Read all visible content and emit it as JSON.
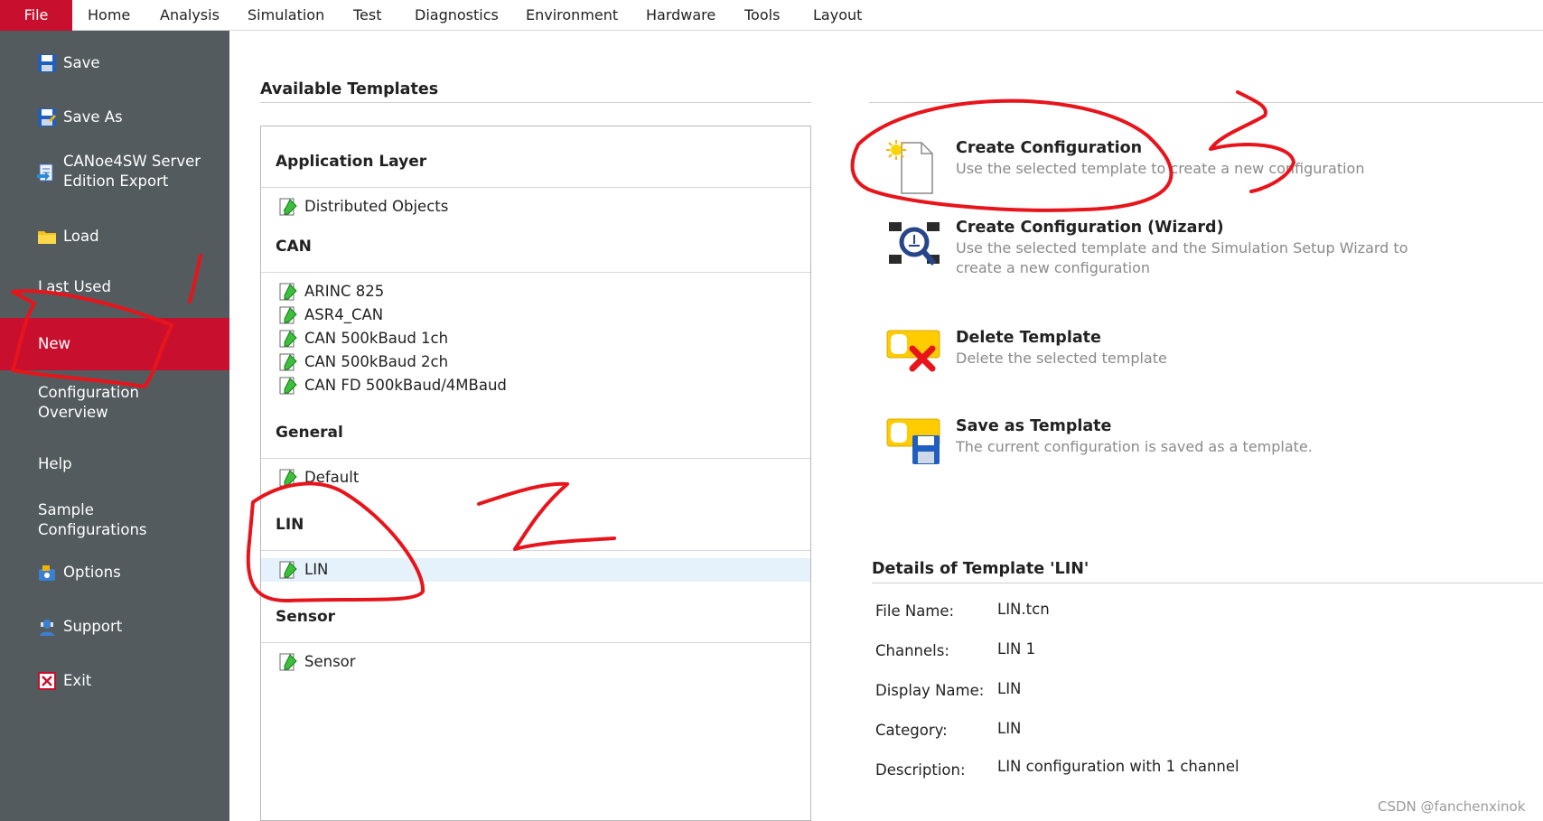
{
  "menubar": {
    "file": "File",
    "tabs": [
      "Home",
      "Analysis",
      "Simulation",
      "Test",
      "Diagnostics",
      "Environment",
      "Hardware",
      "Tools",
      "Layout"
    ]
  },
  "backstage": {
    "items": [
      {
        "label": "Save",
        "icon": "save-icon"
      },
      {
        "label": "Save As",
        "icon": "save-as-icon"
      },
      {
        "label": "CANoe4SW Server\nEdition Export",
        "icon": "export-icon"
      },
      {
        "label": "Load",
        "icon": "folder-icon"
      },
      {
        "label": "Last Used",
        "icon": ""
      },
      {
        "label": "New",
        "icon": "",
        "active": true
      },
      {
        "label": "Configuration\nOverview",
        "icon": ""
      },
      {
        "label": "Help",
        "icon": ""
      },
      {
        "label": "Sample\nConfigurations",
        "icon": ""
      },
      {
        "label": "Options",
        "icon": "options-icon"
      },
      {
        "label": "Support",
        "icon": "support-icon"
      },
      {
        "label": "Exit",
        "icon": "exit-icon"
      }
    ]
  },
  "templates": {
    "title": "Available Templates",
    "groups": [
      {
        "name": "Application Layer",
        "items": [
          "Distributed Objects"
        ]
      },
      {
        "name": "CAN",
        "items": [
          "ARINC 825",
          "ASR4_CAN",
          "CAN 500kBaud 1ch",
          "CAN 500kBaud 2ch",
          "CAN FD 500kBaud/4MBaud"
        ]
      },
      {
        "name": "General",
        "items": [
          "Default"
        ]
      },
      {
        "name": "LIN",
        "items": [
          "LIN"
        ],
        "selected": "LIN"
      },
      {
        "name": "Sensor",
        "items": [
          "Sensor"
        ]
      }
    ]
  },
  "actions": [
    {
      "title": "Create Configuration",
      "desc": "Use the selected template to create a new configuration",
      "icon": "new-document-icon"
    },
    {
      "title": "Create Configuration (Wizard)",
      "desc": "Use the selected template and the Simulation Setup Wizard to create a new configuration",
      "icon": "wizard-icon"
    },
    {
      "title": "Delete Template",
      "desc": "Delete the selected template",
      "icon": "delete-template-icon"
    },
    {
      "title": "Save as Template",
      "desc": "The current configuration is saved as a template.",
      "icon": "save-template-icon"
    }
  ],
  "details": {
    "title": "Details of Template 'LIN'",
    "rows": [
      {
        "label": "File Name:",
        "value": "LIN.tcn"
      },
      {
        "label": "Channels:",
        "value": "LIN 1"
      },
      {
        "label": "Display Name:",
        "value": "LIN"
      },
      {
        "label": "Category:",
        "value": "LIN"
      },
      {
        "label": "Description:",
        "value": "LIN configuration with 1 channel"
      }
    ]
  },
  "annotations": {
    "marks": [
      "1",
      "2",
      "3"
    ],
    "color": "#e8141b"
  },
  "watermark": "CSDN @fanchenxinok",
  "colors": {
    "accent": "#c8102e",
    "sidebar": "#535b5e",
    "selection": "#e5f1fb"
  }
}
